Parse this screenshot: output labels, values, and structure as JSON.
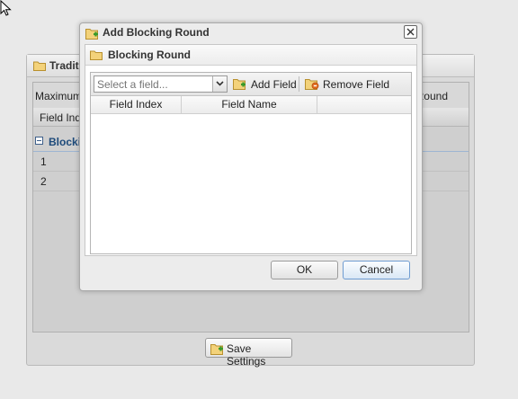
{
  "background": {
    "panel_title": "Tradit",
    "max_label": "Maximum B",
    "max_right_label": "Round",
    "col_field_index": "Field Inde",
    "group_label": "Blockin",
    "rows": [
      "1",
      "2"
    ],
    "save_label": "Save Settings"
  },
  "dialog": {
    "title": "Add Blocking Round",
    "fieldset_title": "Blocking Round",
    "combo_placeholder": "Select a field...",
    "add_field_label": "Add Field",
    "remove_field_label": "Remove Field",
    "columns": [
      "Field Index",
      "Field Name"
    ],
    "ok_label": "OK",
    "cancel_label": "Cancel"
  },
  "icons": {
    "folder": "folder-icon",
    "folder_add": "folder-add-icon",
    "add": "add-field-icon",
    "remove": "remove-field-icon",
    "close": "close-icon",
    "dropdown": "chevron-down-icon",
    "save": "save-icon",
    "cursor": "mouse-cursor-icon"
  },
  "colors": {
    "accent_blue": "#1d4a7a",
    "cancel_border": "#6f9cd1"
  }
}
